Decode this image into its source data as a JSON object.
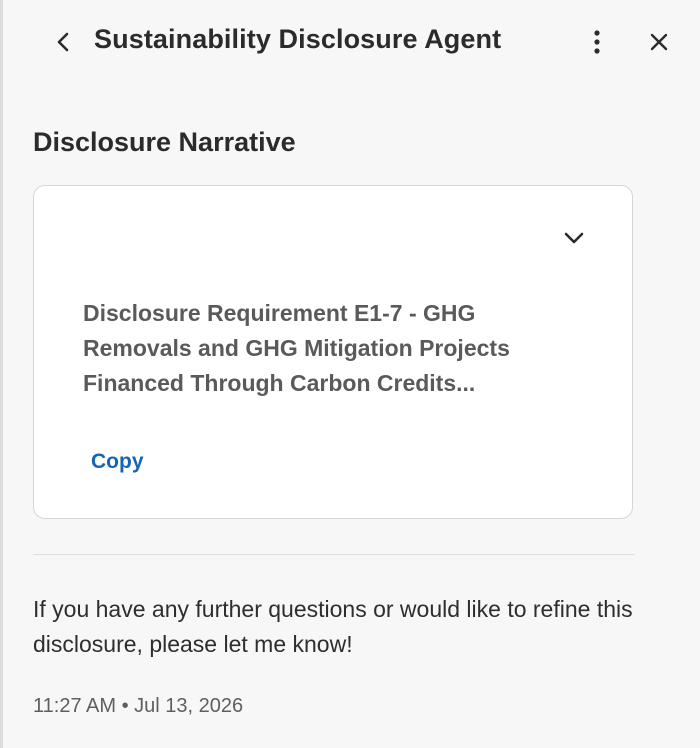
{
  "header": {
    "title": "Sustainability Disclosure Agent",
    "back_icon": "chevron-left-icon",
    "more_icon": "more-vertical-icon",
    "close_icon": "close-icon"
  },
  "section": {
    "title": "Disclosure Narrative"
  },
  "card": {
    "expand_icon": "chevron-down-icon",
    "text": "Disclosure Requirement E1-7 - GHG Removals and GHG Mitigation Projects Financed Through Carbon Credits...",
    "copy_label": "Copy"
  },
  "message": {
    "text": "If you have any further questions or would like to refine this disclosure, please let me know!",
    "time": "11:27 AM",
    "separator": "•",
    "date": "Jul 13, 2026"
  },
  "colors": {
    "background": "#f7f7f7",
    "card": "#ffffff",
    "link": "#1565b7",
    "text": "#2b2b2b"
  }
}
